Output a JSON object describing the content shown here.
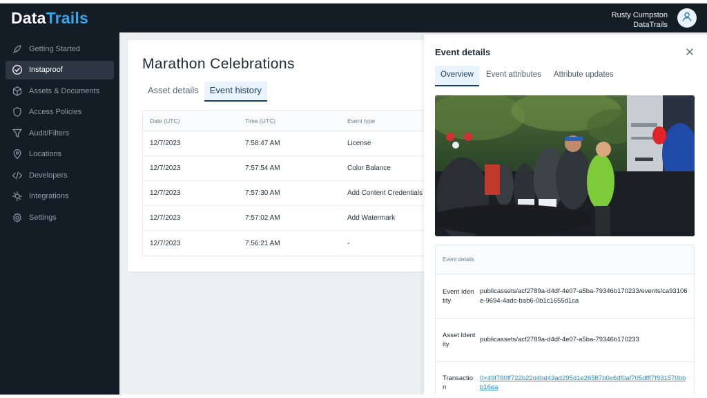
{
  "app": {
    "logo_part1": "Data",
    "logo_part2": "Trails",
    "colors": {
      "sidebar_bg": "#141d26",
      "accent": "#3aa6e8",
      "active_tab_bg": "#e8f3fb",
      "link": "#2b8fd0"
    }
  },
  "user": {
    "name": "Rusty Cumpston",
    "org": "DataTrails",
    "icon": "user-icon"
  },
  "sidebar": {
    "items": [
      {
        "label": "Getting Started",
        "icon": "rocket-icon",
        "active": false
      },
      {
        "label": "Instaproof",
        "icon": "check-circle-icon",
        "active": true
      },
      {
        "label": "Assets & Documents",
        "icon": "cube-icon",
        "active": false
      },
      {
        "label": "Access Policies",
        "icon": "shield-icon",
        "active": false
      },
      {
        "label": "Audit/Filters",
        "icon": "filter-icon",
        "active": false
      },
      {
        "label": "Locations",
        "icon": "location-pin-icon",
        "active": false
      },
      {
        "label": "Developers",
        "icon": "code-icon",
        "active": false
      },
      {
        "label": "Integrations",
        "icon": "integrations-icon",
        "active": false
      },
      {
        "label": "Settings",
        "icon": "gear-icon",
        "active": false
      }
    ]
  },
  "main": {
    "title": "Marathon Celebrations",
    "tabs": [
      {
        "label": "Asset details",
        "active": false
      },
      {
        "label": "Event history",
        "active": true
      }
    ],
    "table": {
      "headers": [
        "Date (UTC)",
        "Time (UTC)",
        "Event type"
      ],
      "rows": [
        [
          "12/7/2023",
          "7:58:47 AM",
          "License"
        ],
        [
          "12/7/2023",
          "7:57:54 AM",
          "Color Balance"
        ],
        [
          "12/7/2023",
          "7:57:30 AM",
          "Add Content Credentials"
        ],
        [
          "12/7/2023",
          "7:57:02 AM",
          "Add Watermark"
        ],
        [
          "12/7/2023",
          "7:56:21 AM",
          "-"
        ]
      ]
    }
  },
  "panel": {
    "title": "Event details",
    "close_icon": "close-icon",
    "tabs": [
      {
        "label": "Overview",
        "active": true
      },
      {
        "label": "Event attributes",
        "active": false
      },
      {
        "label": "Attribute updates",
        "active": false
      }
    ],
    "details_header": "Event details",
    "rows": [
      {
        "key": "Event Identity",
        "value": "publicassets/acf2789a-d4df-4e07-a5ba-79346b170233/events/ca93106e-9694-4adc-bab6-0b1c1655d1ca"
      },
      {
        "key": "Asset Identity",
        "value": "publicassets/acf2789a-d4df-4e07-a5ba-79346b170233"
      },
      {
        "key": "Transaction",
        "value": "0×49f780ff722b22d4bd43ad295d1e26587b0e6df0af705dfff7f931570bbb16ea"
      }
    ]
  }
}
